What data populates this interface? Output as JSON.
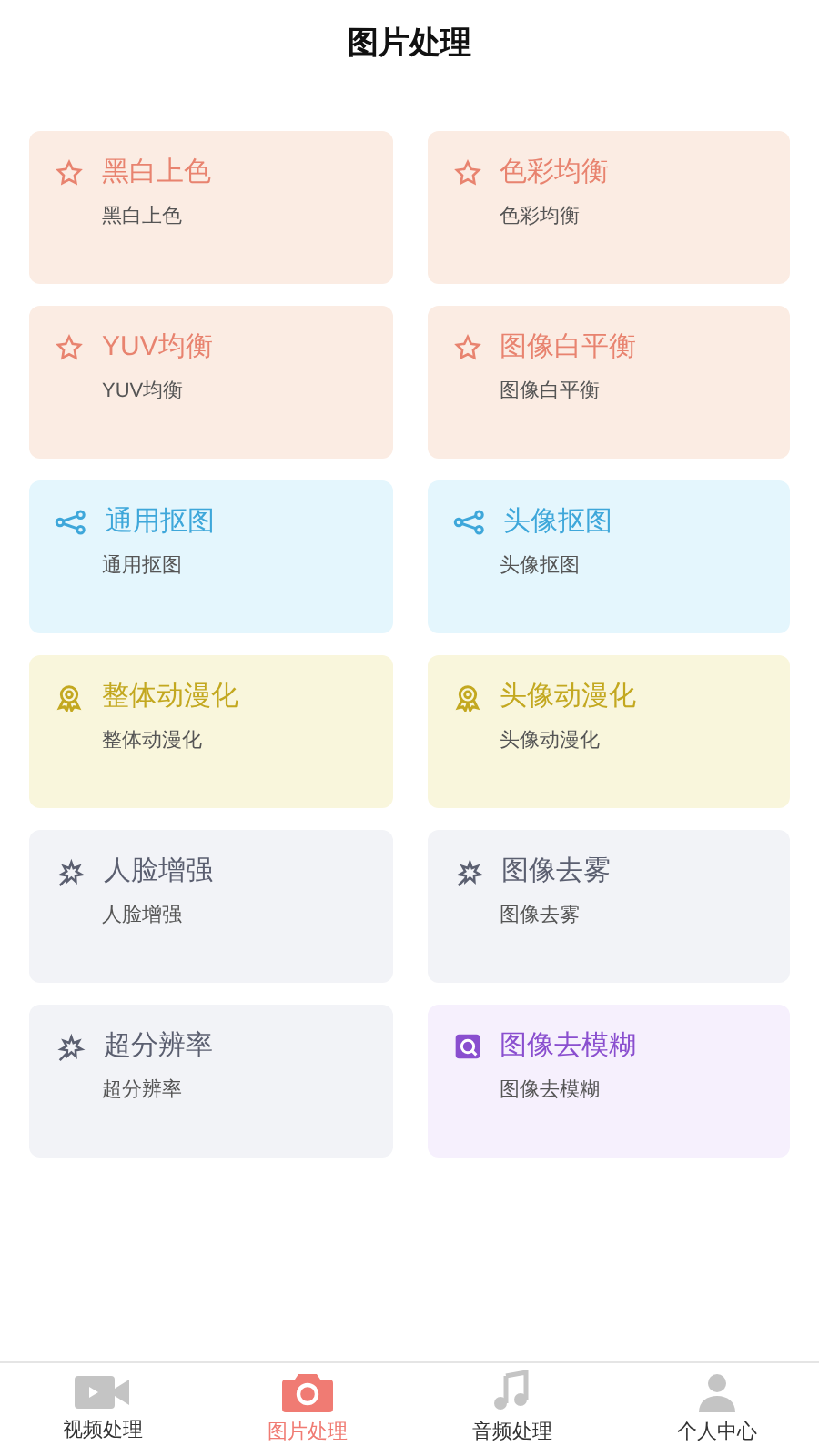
{
  "header": {
    "title": "图片处理"
  },
  "cards": [
    {
      "kind": "star",
      "title": "黑白上色",
      "subtitle": "黑白上色"
    },
    {
      "kind": "star",
      "title": "色彩均衡",
      "subtitle": "色彩均衡"
    },
    {
      "kind": "star",
      "title": "YUV均衡",
      "subtitle": "YUV均衡"
    },
    {
      "kind": "star",
      "title": "图像白平衡",
      "subtitle": "图像白平衡"
    },
    {
      "kind": "share",
      "title": "通用抠图",
      "subtitle": "通用抠图"
    },
    {
      "kind": "share",
      "title": "头像抠图",
      "subtitle": "头像抠图"
    },
    {
      "kind": "badge",
      "title": "整体动漫化",
      "subtitle": "整体动漫化"
    },
    {
      "kind": "badge",
      "title": "头像动漫化",
      "subtitle": "头像动漫化"
    },
    {
      "kind": "sparkle",
      "title": "人脸增强",
      "subtitle": "人脸增强"
    },
    {
      "kind": "sparkle",
      "title": "图像去雾",
      "subtitle": "图像去雾"
    },
    {
      "kind": "sparkle",
      "title": "超分辨率",
      "subtitle": "超分辨率"
    },
    {
      "kind": "lens",
      "title": "图像去模糊",
      "subtitle": "图像去模糊"
    }
  ],
  "tab_bar": [
    {
      "kind": "video",
      "label": "视频处理",
      "selected": false
    },
    {
      "kind": "camera",
      "label": "图片处理",
      "selected": true
    },
    {
      "kind": "music",
      "label": "音频处理",
      "selected": false
    },
    {
      "kind": "person",
      "label": "个人中心",
      "selected": false
    }
  ]
}
